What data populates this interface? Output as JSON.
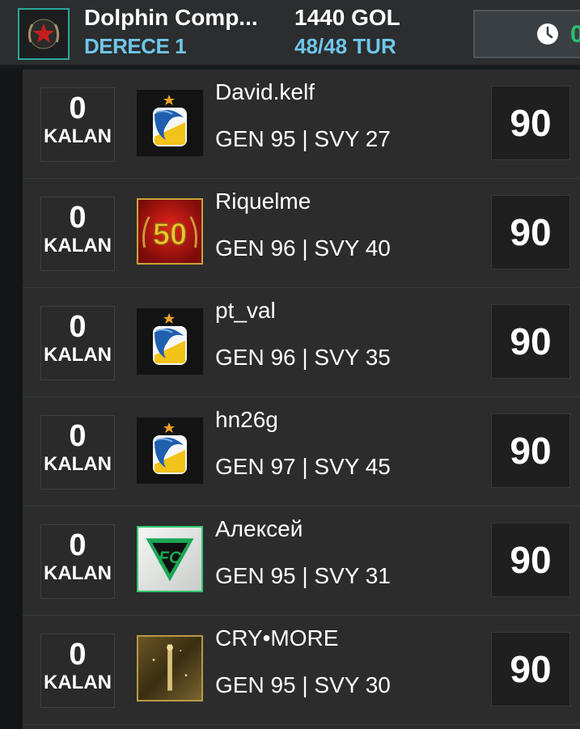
{
  "header": {
    "club_name": "Dolphin Comp...",
    "division": "DERECE 1",
    "goals": "1440 GOL",
    "rounds": "48/48 TUR",
    "timer_partial": "0",
    "accent_color": "#6fc6ea",
    "timer_color": "#27c16f"
  },
  "rows": [
    {
      "remaining": "0",
      "remaining_label": "KALAN",
      "name": "David.kelf",
      "stats": "GEN 95 | SVY 27",
      "score": "90",
      "badge_icon": "dolphin-club-badge-icon"
    },
    {
      "remaining": "0",
      "remaining_label": "KALAN",
      "name": "Riquelme",
      "stats": "GEN 96 | SVY 40",
      "score": "90",
      "badge_icon": "fifty-badge-icon",
      "badge_text": "50"
    },
    {
      "remaining": "0",
      "remaining_label": "KALAN",
      "name": "pt_val",
      "stats": "GEN 96 | SVY 35",
      "score": "90",
      "badge_icon": "dolphin-club-badge-icon"
    },
    {
      "remaining": "0",
      "remaining_label": "KALAN",
      "name": "hn26g",
      "stats": "GEN 97 | SVY 45",
      "score": "90",
      "badge_icon": "dolphin-club-badge-icon"
    },
    {
      "remaining": "0",
      "remaining_label": "KALAN",
      "name": "Алексей",
      "stats": "GEN 95 | SVY 31",
      "score": "90",
      "badge_icon": "fc-logo-badge-icon"
    },
    {
      "remaining": "0",
      "remaining_label": "KALAN",
      "name": "CRY•MORE",
      "stats": "GEN 95 | SVY 30",
      "score": "90",
      "badge_icon": "gold-trophy-badge-icon"
    }
  ]
}
